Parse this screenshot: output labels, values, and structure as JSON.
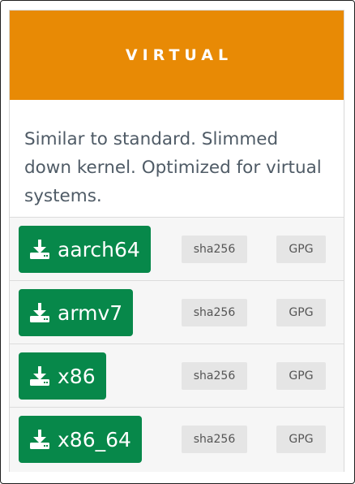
{
  "card": {
    "title": "VIRTUAL",
    "description": "Similar to standard. Slimmed down kernel. Optimized for virtual systems.",
    "header_color": "#e88a05",
    "button_color": "#07884a"
  },
  "downloads": [
    {
      "arch": "aarch64",
      "sha_label": "sha256",
      "gpg_label": "GPG",
      "icon": "download-icon"
    },
    {
      "arch": "armv7",
      "sha_label": "sha256",
      "gpg_label": "GPG",
      "icon": "download-icon"
    },
    {
      "arch": "x86",
      "sha_label": "sha256",
      "gpg_label": "GPG",
      "icon": "download-icon"
    },
    {
      "arch": "x86_64",
      "sha_label": "sha256",
      "gpg_label": "GPG",
      "icon": "download-icon"
    }
  ]
}
